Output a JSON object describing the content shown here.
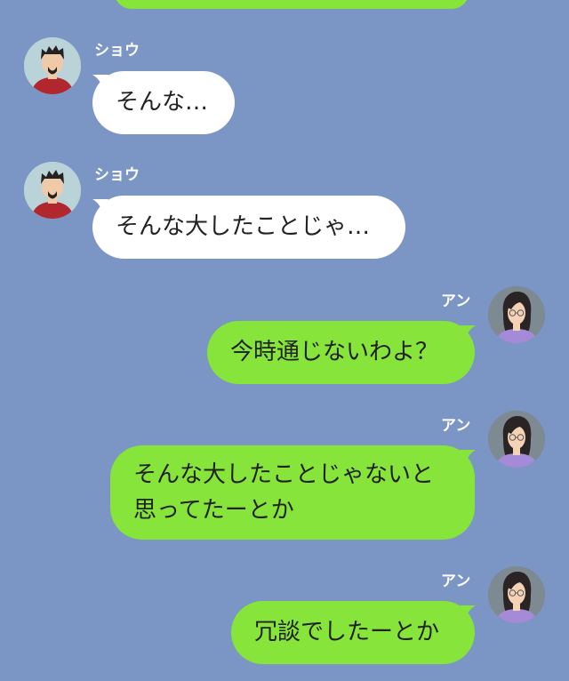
{
  "messages": [
    {
      "sender": "ショウ",
      "side": "left",
      "text": "そんな…"
    },
    {
      "sender": "ショウ",
      "side": "left",
      "text": "そんな大したことじゃ…"
    },
    {
      "sender": "アン",
      "side": "right",
      "text": "今時通じないわよ？"
    },
    {
      "sender": "アン",
      "side": "right",
      "lines": [
        "そんな大したことじゃないと",
        "思ってたーとか"
      ]
    },
    {
      "sender": "アン",
      "side": "right",
      "text": "冗談でしたーとか"
    }
  ],
  "avatars": {
    "sho": "man-avatar-icon",
    "an": "woman-avatar-icon"
  },
  "colors": {
    "background": "#7b95c4",
    "incoming": "#ffffff",
    "outgoing": "#86e43a",
    "name": "#ffffff"
  }
}
